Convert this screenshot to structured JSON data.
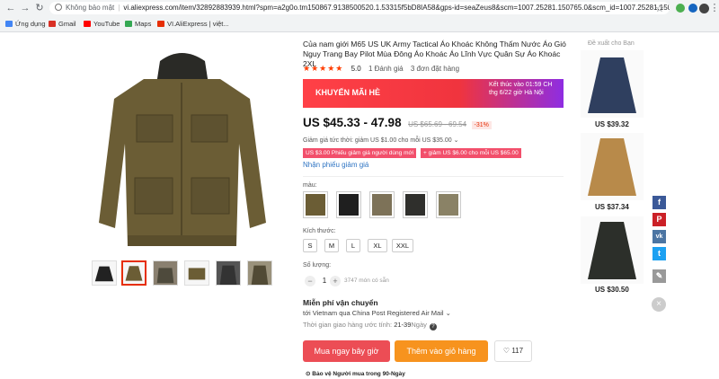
{
  "browser": {
    "security_label": "Không bảo mật",
    "url": "vi.aliexpress.com/item/32892883939.html?spm=a2g0o.tm150867.9138500520.1.53315f5bD8IA58&gps-id=seaZeus8&scm=1007.25281.150765.0&scm_id=1007.25281.150765.0&sc...",
    "bookmarks": [
      {
        "label": "Ứng dụng",
        "icon": "apps-grid-icon",
        "color": "#4285f4"
      },
      {
        "label": "Gmail",
        "icon": "gmail-icon",
        "color": "#d93025"
      },
      {
        "label": "YouTube",
        "icon": "youtube-icon",
        "color": "#ff0000"
      },
      {
        "label": "Maps",
        "icon": "maps-icon",
        "color": "#34a853"
      },
      {
        "label": "VI.AliExpress | việt...",
        "icon": "aliexpress-icon",
        "color": "#e62e04"
      }
    ]
  },
  "product": {
    "title": "Của nam giới M65 US UK Army Tactical Áo Khoác Không Thấm Nước Áo Gió Nguy Trang Bay Pilot Mùa Đông Áo Khoác Áo Lĩnh Vực Quân Sự Áo Khoác 2XL",
    "stars": "★★★★★",
    "rating": "5.0",
    "reviews": "1 Đánh giá",
    "orders": "3 đơn đặt hàng",
    "promo_label": "KHUYẾN MÃI HÈ",
    "promo_end": "Kết thúc vào 01:59 CH thg 6/22 giờ Hà Nội",
    "price": "US $45.33 - 47.98",
    "old_price": "US $65.69 - 69.54",
    "discount": "-31%",
    "instant_discount": "Giảm giá tức thời: giảm US $1.00 cho mỗi US $35.00",
    "coupons": [
      "US $3.00 Phiếu giảm giá người dùng mới",
      "+ giảm US $6.00 cho mỗi US $65.00"
    ],
    "coupon_link": "Nhận phiếu giảm giá",
    "color_label": "màu:",
    "size_label": "Kích thước:",
    "sizes": [
      "S",
      "M",
      "L",
      "XL",
      "XXL"
    ],
    "qty_label": "Số lượng:",
    "qty": "1",
    "minus": "−",
    "plus": "+",
    "available": "3747 món có sẵn",
    "shipping_title": "Miễn phí vận chuyển",
    "shipping_to": "tới Vietnam qua China Post Registered Air Mail",
    "delivery_label": "Thời gian giao hàng ước tính:",
    "delivery_days": "21-39",
    "delivery_unit": "Ngày",
    "buy_now": "Mua ngay bây giờ",
    "add_to_cart": "Thêm vào giỏ hàng",
    "wishlist_count": "117",
    "protection": "Bảo vệ Người mua trong 90-Ngày"
  },
  "recommendations": {
    "title": "Đề xuất cho Bạn",
    "items": [
      {
        "price": "US $39.32",
        "color": "#2f3f5f"
      },
      {
        "price": "US $37.34",
        "color": "#b88a4a"
      },
      {
        "price": "US $30.50",
        "color": "#2c2f2a"
      }
    ]
  },
  "social": [
    "f",
    "P",
    "vk",
    "t",
    "✎"
  ],
  "colors": {
    "accent": "#e62e04",
    "buy": "#ec4d55",
    "cart": "#f7931e",
    "jacket": "#6b5d35"
  }
}
